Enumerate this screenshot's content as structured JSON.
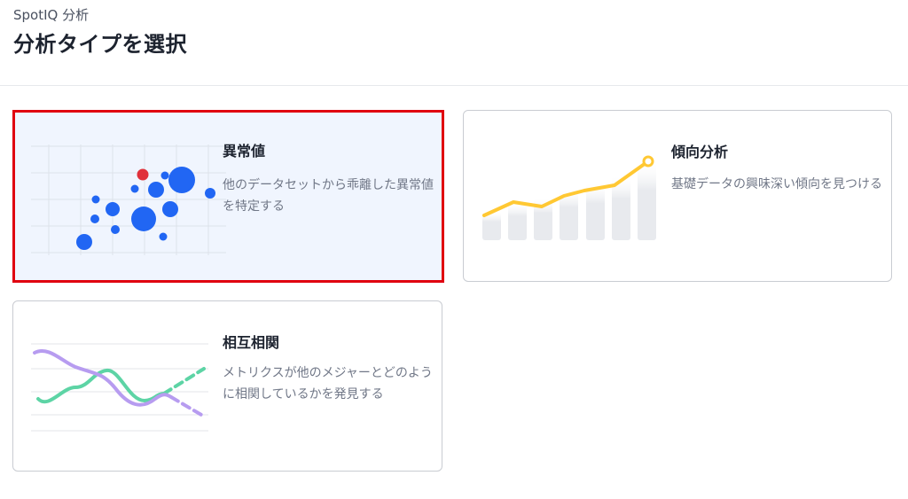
{
  "header": {
    "subtitle": "SpotIQ 分析",
    "title": "分析タイプを選択"
  },
  "cards": [
    {
      "id": "anomaly",
      "title": "異常値",
      "description": "他のデータセットから乖離した異常値を特定する",
      "selected": true,
      "icon": "anomaly-scatter-illustration"
    },
    {
      "id": "trend",
      "title": "傾向分析",
      "description": "基礎データの興味深い傾向を見つける",
      "selected": false,
      "icon": "trend-bar-line-illustration"
    },
    {
      "id": "correlation",
      "title": "相互相関",
      "description": "メトリクスが他のメジャーとどのように相関しているかを発見する",
      "selected": false,
      "icon": "correlation-wave-illustration"
    }
  ],
  "colors": {
    "selected_border": "#e0000f",
    "selected_bg": "#f0f5fe",
    "dot_blue": "#2166f3",
    "dot_red": "#e0303a",
    "trend_line": "#ffc833",
    "trend_bars": "#e8eaee",
    "wave_green": "#5dd4a5",
    "wave_purple": "#b79cf0"
  }
}
